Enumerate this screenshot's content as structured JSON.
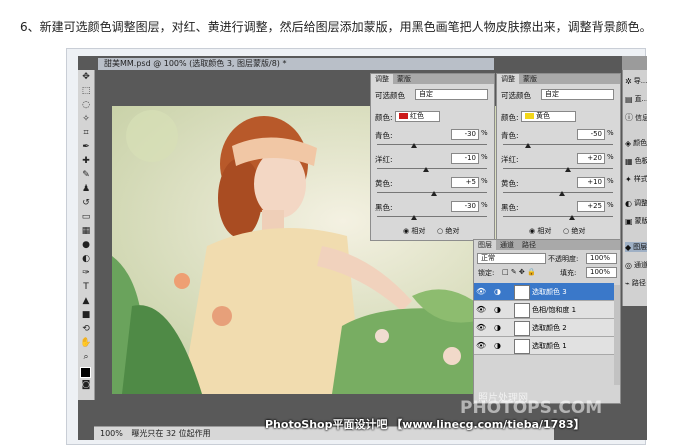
{
  "caption": "6、新建可选颜色调整图层，对红、黄进行调整，然后给图层添加蒙版，用黑色画笔把人物皮肤擦出来，调整背景颜色。",
  "document": {
    "tab_title": "甜美MM.psd @ 100% (选取颜色 3, 图层蒙版/8) *",
    "status_zoom": "100%",
    "status_text": "曝光只在 32 位起作用"
  },
  "adjust_left": {
    "tabs": [
      "调整",
      "蒙版"
    ],
    "preset_label": "可选颜色",
    "preset_value": "自定",
    "color_label": "颜色:",
    "color_value": "红色",
    "color_hex": "#cc1a1a",
    "sliders": [
      {
        "label": "青色:",
        "value": "-30"
      },
      {
        "label": "洋红:",
        "value": "-10"
      },
      {
        "label": "黄色:",
        "value": "+5"
      },
      {
        "label": "黑色:",
        "value": "-30"
      }
    ],
    "pct": "%",
    "radio_relative": "相对",
    "radio_absolute": "绝对"
  },
  "adjust_right": {
    "tabs": [
      "调整",
      "蒙版"
    ],
    "preset_label": "可选颜色",
    "preset_value": "自定",
    "color_label": "颜色:",
    "color_value": "黄色",
    "color_hex": "#f2d61a",
    "sliders": [
      {
        "label": "青色:",
        "value": "-50"
      },
      {
        "label": "洋红:",
        "value": "+20"
      },
      {
        "label": "黄色:",
        "value": "+10"
      },
      {
        "label": "黑色:",
        "value": "+25"
      }
    ],
    "pct": "%",
    "radio_relative": "相对",
    "radio_absolute": "绝对"
  },
  "layers": {
    "tabs": [
      "图层",
      "通道",
      "路径"
    ],
    "blend_mode": "正常",
    "opacity_label": "不透明度:",
    "opacity_value": "100%",
    "lock_label": "锁定:",
    "fill_label": "填充:",
    "fill_value": "100%",
    "items": [
      {
        "name": "选取颜色 3",
        "active": true
      },
      {
        "name": "色相/饱和度 1",
        "active": false
      },
      {
        "name": "选取颜色 2",
        "active": false
      },
      {
        "name": "选取颜色 1",
        "active": false
      }
    ]
  },
  "dock": {
    "items": [
      {
        "label": "导...",
        "icon": "navigator-icon"
      },
      {
        "label": "直...",
        "icon": "histogram-icon"
      },
      {
        "label": "信息",
        "icon": "info-icon"
      },
      {
        "label": "颜色",
        "icon": "color-icon"
      },
      {
        "label": "色板",
        "icon": "swatches-icon"
      },
      {
        "label": "样式",
        "icon": "styles-icon"
      },
      {
        "label": "调整",
        "icon": "adjustments-icon"
      },
      {
        "label": "蒙版",
        "icon": "masks-icon"
      },
      {
        "label": "图层",
        "icon": "layers-icon"
      },
      {
        "label": "通道",
        "icon": "channels-icon"
      },
      {
        "label": "路径",
        "icon": "paths-icon"
      }
    ]
  },
  "watermark": {
    "text": "PhotoShop平面设计吧 【www.linecg.com/tieba/1783】",
    "big": "PHOTOPS.COM",
    "small": "照片处理网"
  }
}
